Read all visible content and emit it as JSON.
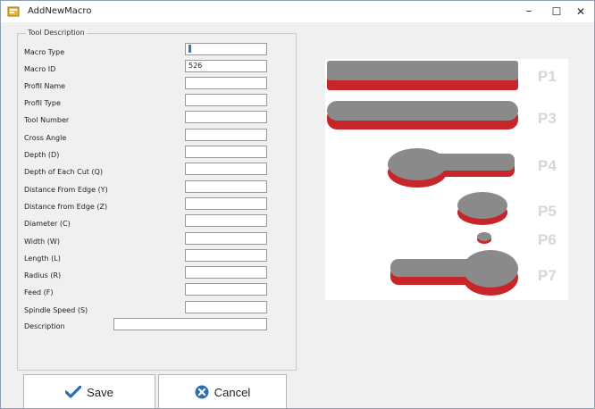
{
  "window": {
    "title": "AddNewMacro",
    "minimize_label": "–",
    "maximize_label": "☐",
    "close_label": "✕"
  },
  "form": {
    "group_title": "Tool Description",
    "fields": [
      {
        "label": "Macro Type",
        "value": ""
      },
      {
        "label": "Macro ID",
        "value": "526"
      },
      {
        "label": "Profil Name",
        "value": ""
      },
      {
        "label": "Profil Type",
        "value": ""
      },
      {
        "label": "Tool Number",
        "value": ""
      },
      {
        "label": "Cross Angle",
        "value": ""
      },
      {
        "label": "Depth (D)",
        "value": ""
      },
      {
        "label": "Depth of Each Cut (Q)",
        "value": ""
      },
      {
        "label": "Distance From Edge (Y)",
        "value": ""
      },
      {
        "label": "Distance from Edge (Z)",
        "value": ""
      },
      {
        "label": "Diameter (C)",
        "value": ""
      },
      {
        "label": "Width (W)",
        "value": ""
      },
      {
        "label": "Length (L)",
        "value": ""
      },
      {
        "label": "Radius (R)",
        "value": ""
      },
      {
        "label": "Feed (F)",
        "value": ""
      },
      {
        "label": "Spindle Speed (S)",
        "value": ""
      }
    ],
    "description": {
      "label": "Description",
      "value": ""
    }
  },
  "preview": {
    "profiles": [
      "P1",
      "P3",
      "P4",
      "P5",
      "P6",
      "P7"
    ],
    "colors": {
      "top": "#8a8a8a",
      "side": "#c8252a",
      "label": "#d6d6d6"
    }
  },
  "buttons": {
    "save_label": "Save",
    "cancel_label": "Cancel"
  },
  "colors": {
    "save_icon": "#2f6db5",
    "cancel_icon": "#2f6db5"
  }
}
